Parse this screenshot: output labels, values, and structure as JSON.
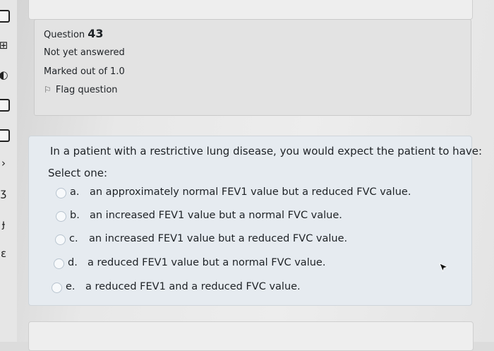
{
  "question": {
    "label": "Question",
    "number": "43",
    "status": "Not yet answered",
    "marked_out_of": "Marked out of 1.0",
    "flag_label": "Flag question",
    "text": "In a patient with a restrictive lung disease, you would expect the patient to have:",
    "prompt": "Select one:",
    "options": [
      {
        "letter": "a.",
        "text": "an approximately normal FEV1 value but a reduced FVC value."
      },
      {
        "letter": "b.",
        "text": "an increased FEV1 value but a normal FVC value."
      },
      {
        "letter": "c.",
        "text": "an increased FEV1 value but a reduced FVC value."
      },
      {
        "letter": "d.",
        "text": "a reduced FEV1 value but a normal FVC value."
      },
      {
        "letter": "e.",
        "text": "a reduced FEV1 and a reduced FVC value."
      }
    ]
  },
  "icons": {
    "flag": "flag-icon",
    "cursor": "mouse-cursor-icon"
  }
}
